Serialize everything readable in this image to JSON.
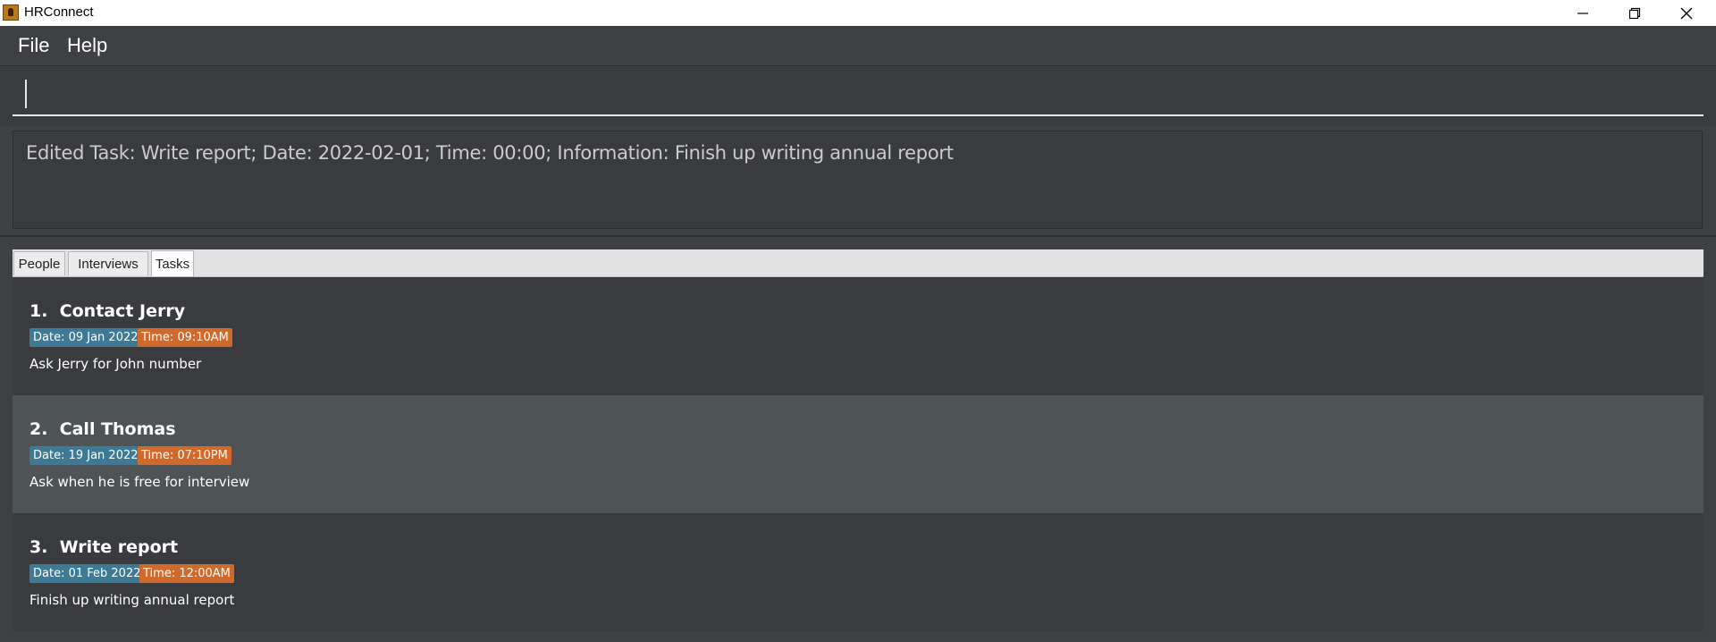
{
  "window": {
    "title": "HRConnect",
    "controls": {
      "minimize": "minimize",
      "restore": "restore",
      "close": "close"
    }
  },
  "menu": {
    "items": [
      {
        "label": "File"
      },
      {
        "label": "Help"
      }
    ]
  },
  "command": {
    "value": "",
    "placeholder": ""
  },
  "result": {
    "text": "Edited Task: Write report; Date: 2022-02-01; Time: 00:00; Information: Finish up writing annual report"
  },
  "tabs": [
    {
      "label": "People",
      "selected": false
    },
    {
      "label": "Interviews",
      "selected": false
    },
    {
      "label": "Tasks",
      "selected": true
    }
  ],
  "tasks": [
    {
      "title": "1.  Contact Jerry",
      "date": "Date: 09 Jan 2022",
      "time": "Time: 09:10AM",
      "info": "Ask Jerry for John number"
    },
    {
      "title": "2.  Call Thomas",
      "date": "Date: 19 Jan 2022",
      "time": "Time: 07:10PM",
      "info": "Ask when he is free for interview"
    },
    {
      "title": "3.  Write report",
      "date": "Date: 01 Feb 2022",
      "time": "Time: 12:00AM",
      "info": "Finish up writing annual report"
    }
  ],
  "colors": {
    "background": "#3f4043",
    "date_tag": "#3d7a96",
    "time_tag": "#d0692a",
    "selected_row": "#4e5356"
  }
}
